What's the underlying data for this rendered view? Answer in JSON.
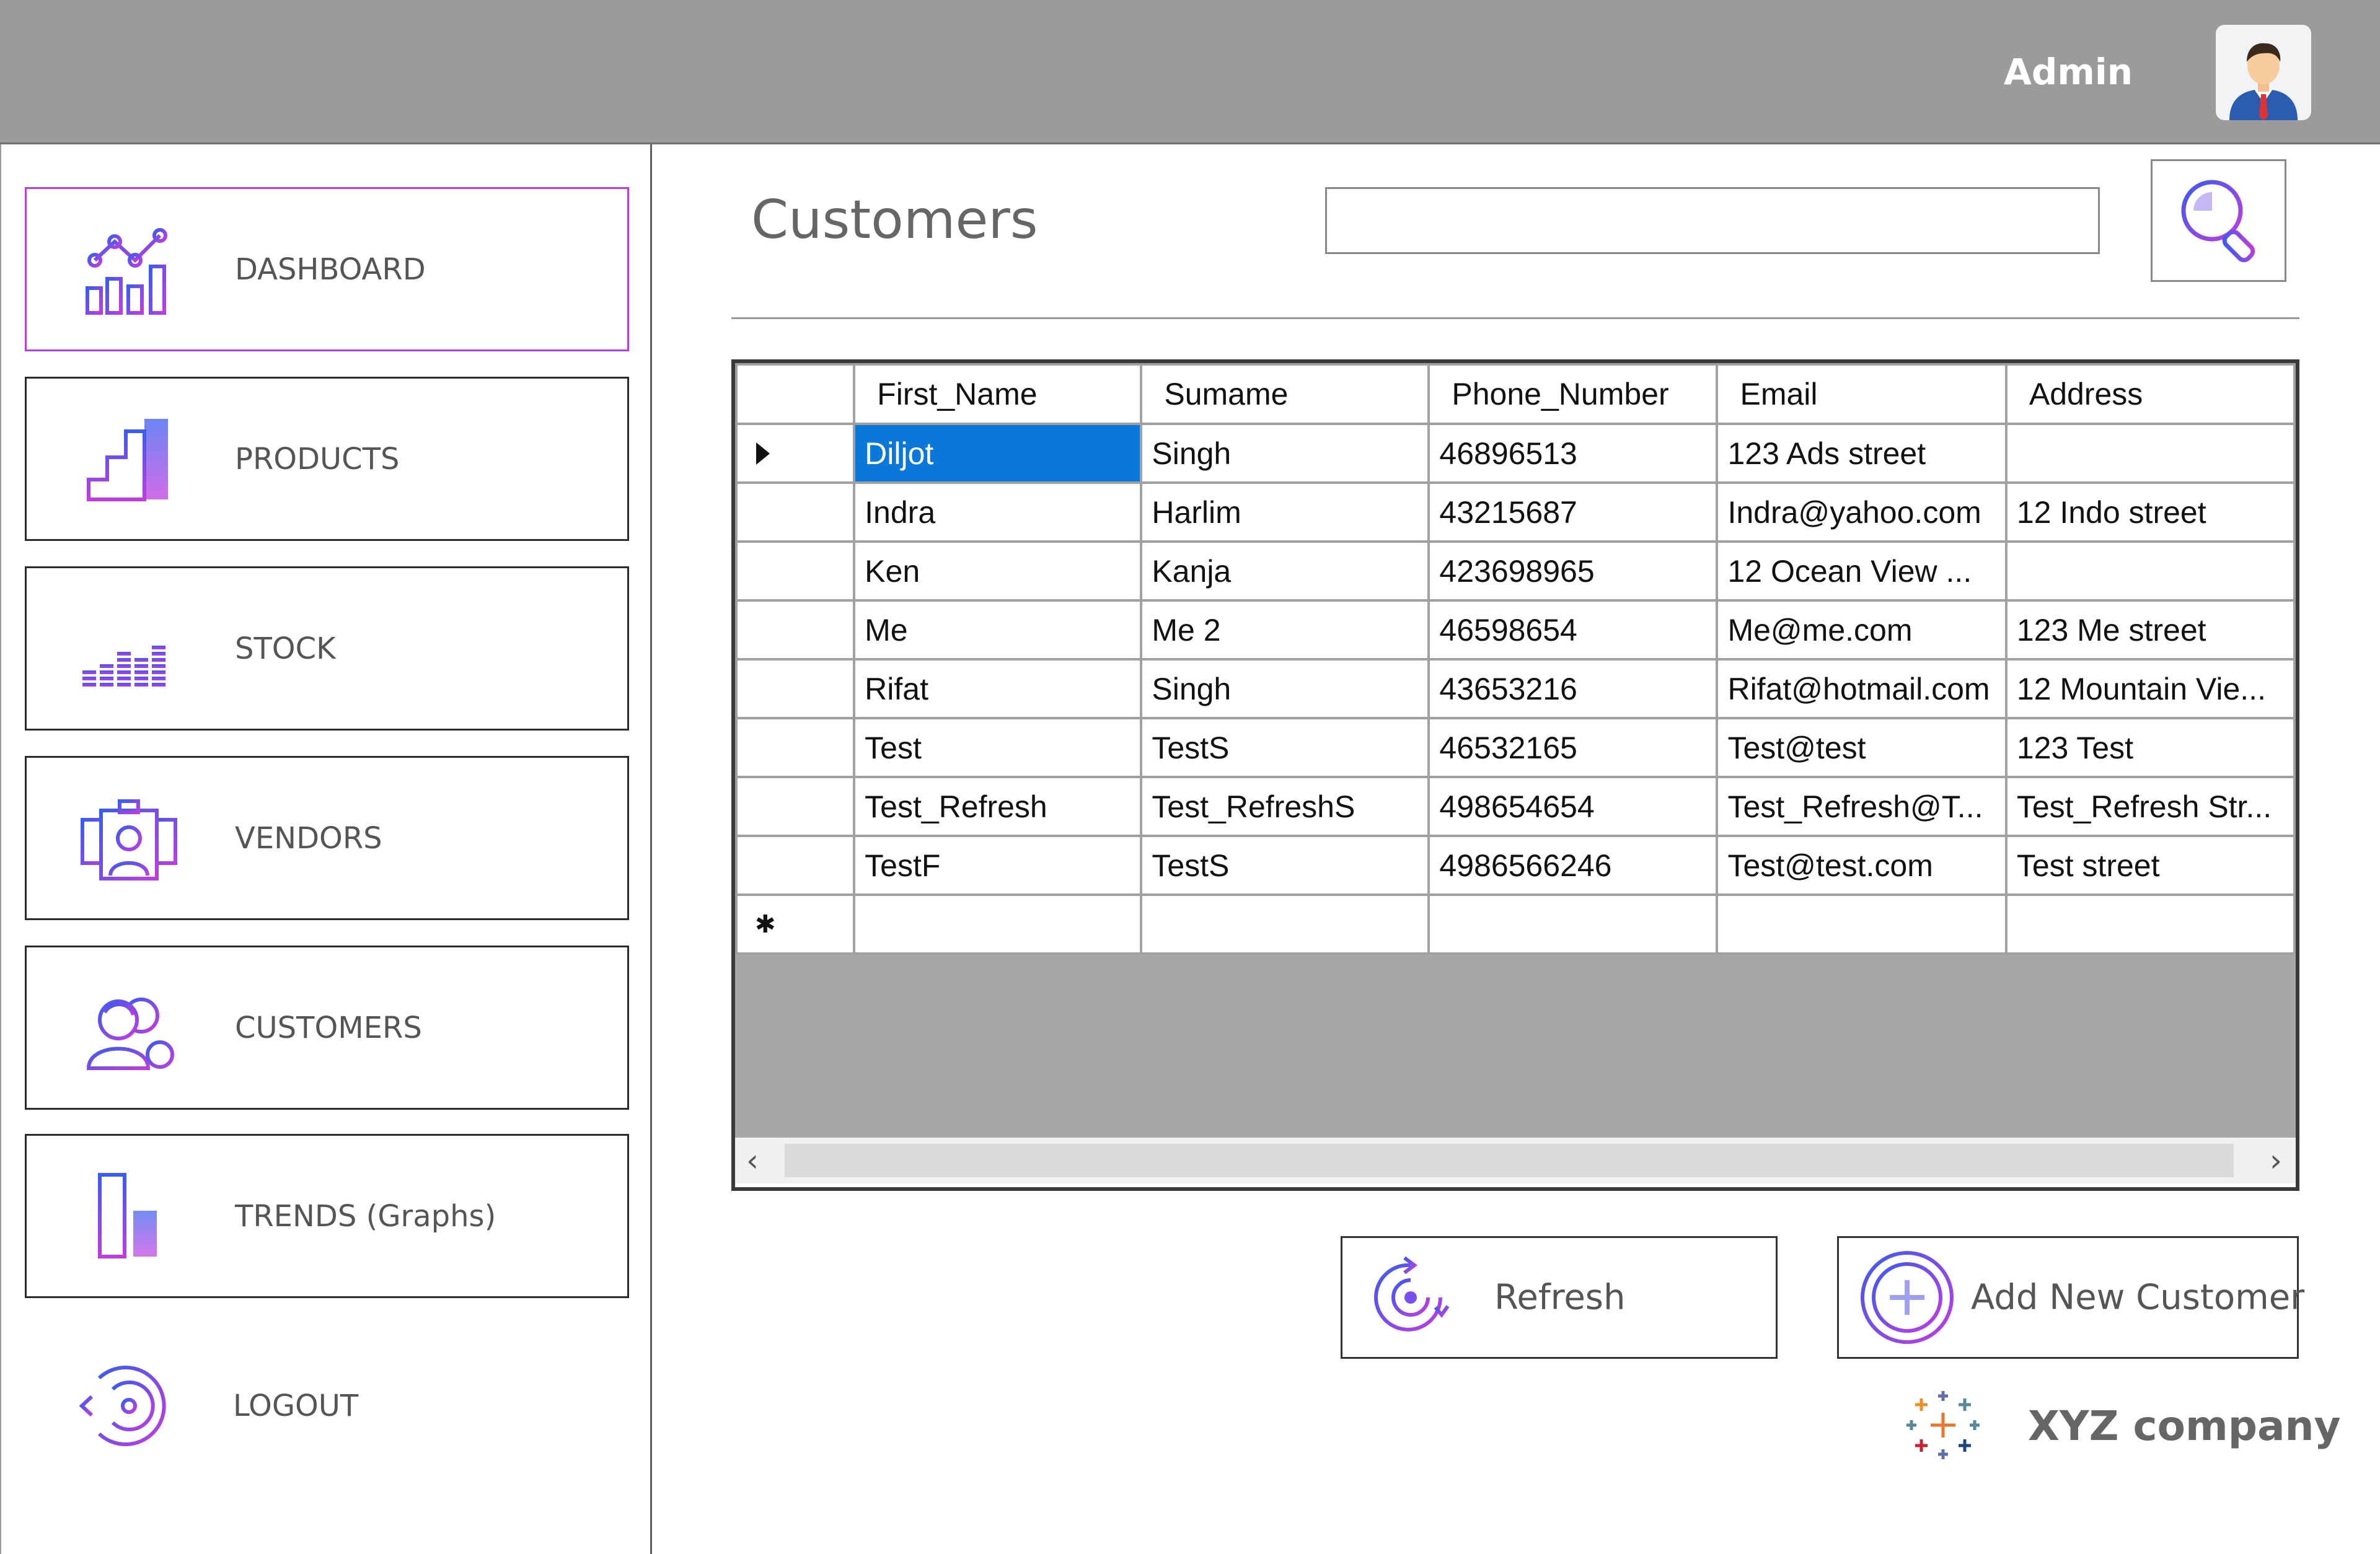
{
  "header": {
    "user_label": "Admin"
  },
  "sidebar": {
    "items": [
      {
        "label": "DASHBOARD",
        "icon": "dashboard-chart-icon",
        "active": true
      },
      {
        "label": "PRODUCTS",
        "icon": "products-steps-icon"
      },
      {
        "label": "STOCK",
        "icon": "stock-equalizer-icon"
      },
      {
        "label": "VENDORS",
        "icon": "vendors-badge-icon"
      },
      {
        "label": "CUSTOMERS",
        "icon": "customers-add-icon"
      },
      {
        "label": "TRENDS (Graphs)",
        "icon": "trends-bar-icon"
      },
      {
        "label": "LOGOUT",
        "icon": "logout-icon"
      }
    ]
  },
  "main": {
    "title": "Customers",
    "search": {
      "value": "",
      "placeholder": ""
    }
  },
  "grid": {
    "columns": [
      "First_Name",
      "Sumame",
      "Phone_Number",
      "Email",
      "Address"
    ],
    "rows": [
      [
        "Diljot",
        "Singh",
        "46896513",
        "123 Ads street",
        ""
      ],
      [
        "Indra",
        "Harlim",
        "43215687",
        "Indra@yahoo.com",
        "12 Indo street"
      ],
      [
        "Ken",
        "Kanja",
        "423698965",
        "12 Ocean View ...",
        ""
      ],
      [
        "Me",
        "Me 2",
        "46598654",
        "Me@me.com",
        "123 Me street"
      ],
      [
        "Rifat",
        "Singh",
        "43653216",
        "Rifat@hotmail.com",
        "12 Mountain Vie..."
      ],
      [
        "Test",
        "TestS",
        "46532165",
        "Test@test",
        "123 Test"
      ],
      [
        "Test_Refresh",
        "Test_RefreshS",
        "498654654",
        "Test_Refresh@T...",
        "Test_Refresh Str..."
      ],
      [
        "TestF",
        "TestS",
        "4986566246",
        "Test@test.com",
        "Test street"
      ]
    ],
    "current_row_indicator": "▶",
    "new_row_indicator": "✱"
  },
  "actions": {
    "refresh_label": "Refresh",
    "add_label": "Add New Customer"
  },
  "footer": {
    "company": "XYZ company"
  },
  "colors": {
    "accent": "#8a3ff0",
    "selection": "#0a78d8",
    "header": "#9b9b9b"
  }
}
